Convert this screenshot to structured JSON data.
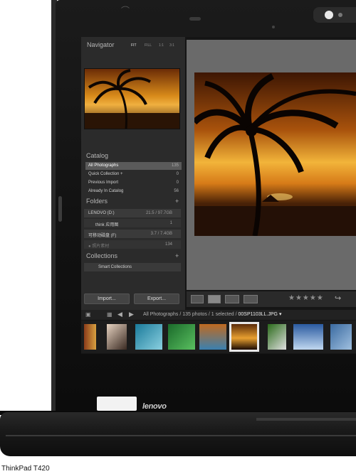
{
  "device": {
    "logo": "lenovo",
    "model_label": "ThinkPad T420"
  },
  "navigator": {
    "title": "Navigator",
    "zoom_options": [
      "FIT",
      "FILL",
      "1:1",
      "3:1"
    ]
  },
  "catalog": {
    "title": "Catalog",
    "items": [
      {
        "label": "All Photographs",
        "count": "135",
        "selected": true
      },
      {
        "label": "Quick Collection +",
        "count": "0"
      },
      {
        "label": "Previous Import",
        "count": "0"
      },
      {
        "label": "Already In Catalog",
        "count": "56"
      }
    ]
  },
  "folders": {
    "title": "Folders",
    "items": [
      {
        "label": "LENOVO (D:)",
        "count": "21.5 / 97.7GB"
      },
      {
        "label": "think 应用图",
        "count": "1"
      },
      {
        "label": "可移动磁盘 (F)",
        "count": "3.7 / 7.4GB"
      },
      {
        "label": "● 照片素材",
        "count": "134"
      }
    ]
  },
  "collections": {
    "title": "Collections",
    "items": [
      {
        "label": "Smart Collections"
      }
    ]
  },
  "buttons": {
    "import": "Import...",
    "export": "Export..."
  },
  "toolbar": {
    "rating": "★★★★★"
  },
  "filmstrip": {
    "path_prefix": "All Photographs / 135 photos / 1 selected /",
    "selected_file": "00SP1103LL.JPG ▾"
  },
  "colors": {
    "panel": "#2b2b2b",
    "selected_row": "#5a5a5a",
    "main_bg": "#6a6a6a"
  }
}
